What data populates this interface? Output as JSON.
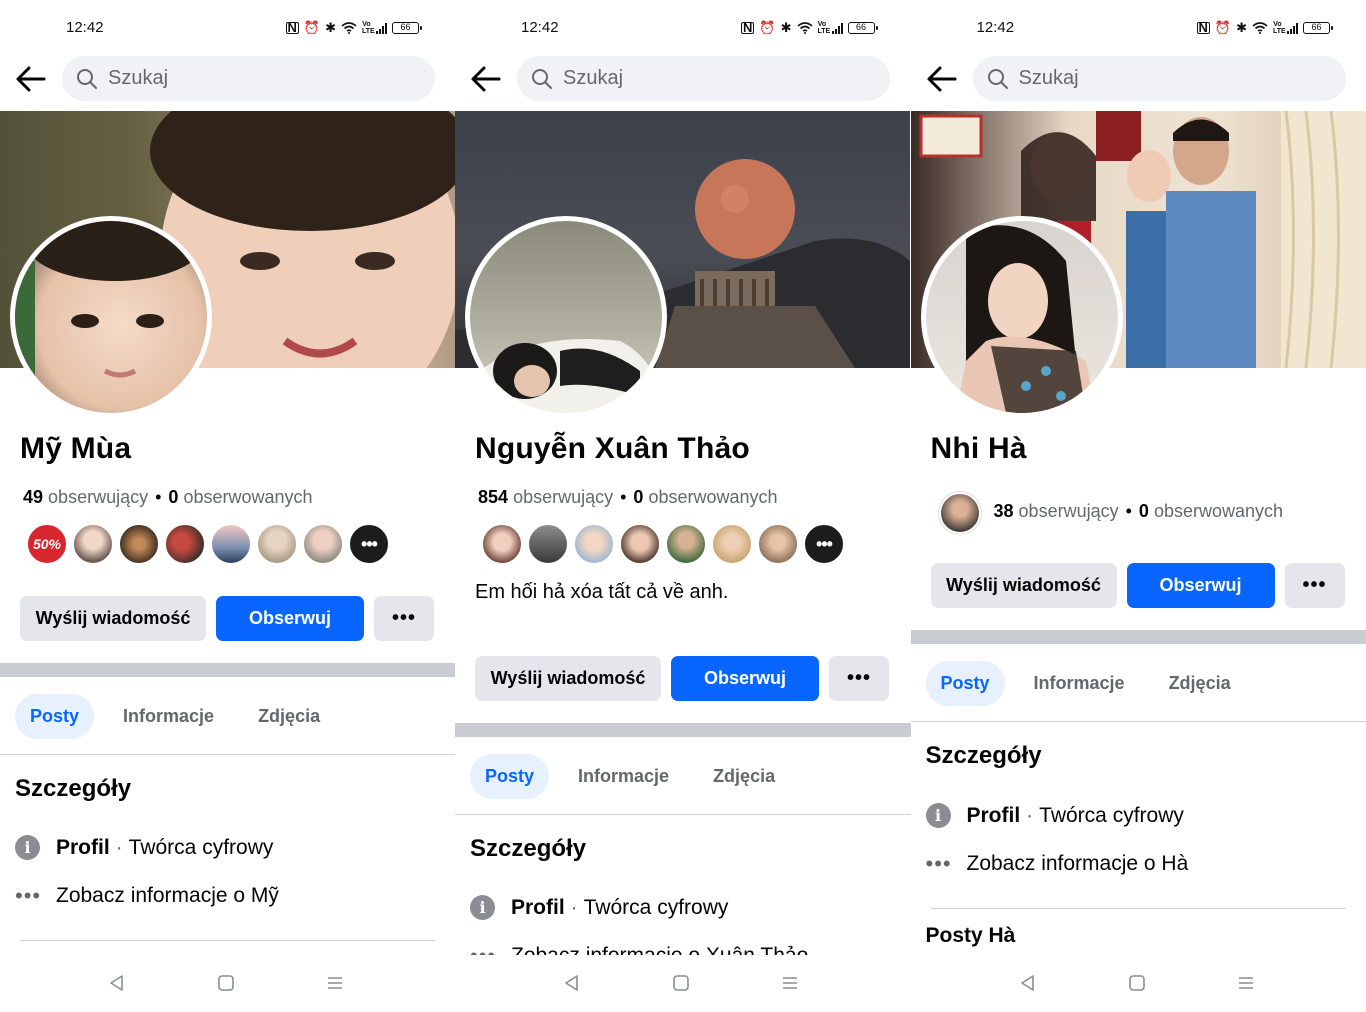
{
  "common": {
    "time": "12:42",
    "battery": "66",
    "volte": "Vo LTE",
    "nfc": "N",
    "search_placeholder": "Szukaj",
    "msg_label": "Wyślij wiadomość",
    "follow_label": "Obserwuj",
    "more_label": "•••",
    "tabs": [
      "Posty",
      "Informacje",
      "Zdjęcia"
    ],
    "details_title": "Szczegóły",
    "profile_bold": "Profil",
    "profile_sep": "·",
    "profile_type": "Twórca cyfrowy",
    "followers_word": "obserwujący",
    "following_word": "obserwowanych",
    "dot": "•"
  },
  "profiles": [
    {
      "name": "Mỹ Mùa",
      "followers": "49",
      "following": "0",
      "see_info": "Zobacz informacje o Mỹ",
      "sale_badge": "50%"
    },
    {
      "name": "Nguyễn Xuân Thảo",
      "followers": "854",
      "following": "0",
      "bio": "Em hối hả xóa tất cả về anh.",
      "see_info": "Zobacz informacje o Xuân Thảo"
    },
    {
      "name": "Nhi Hà",
      "followers": "38",
      "following": "0",
      "see_info": "Zobacz informacje o Hà",
      "posts_title": "Posty Hà"
    }
  ],
  "colors": {
    "accent": "#0866ff",
    "tab_active_bg": "#e7f0fd",
    "button_grey": "#e4e6eb",
    "secondary_text": "#65676b"
  }
}
